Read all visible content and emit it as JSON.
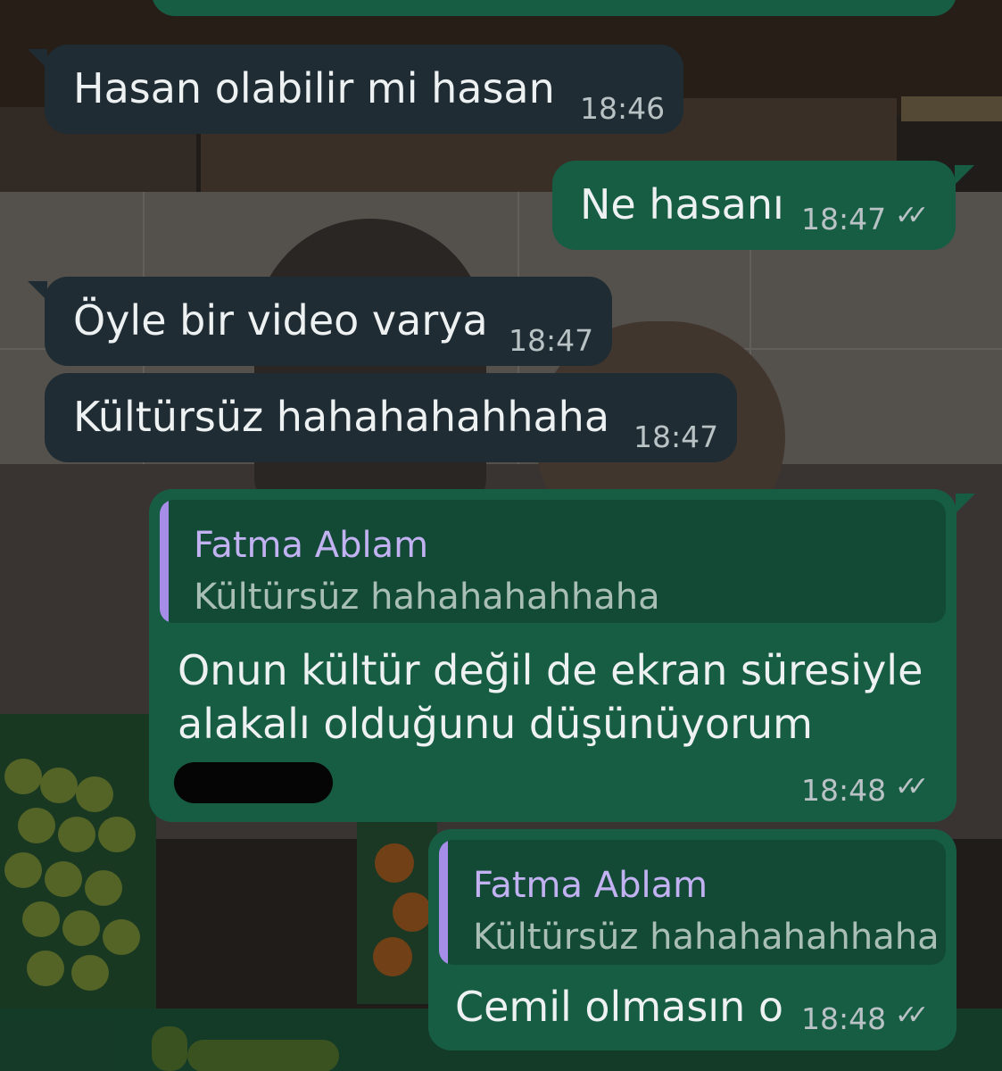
{
  "messages": [
    {
      "direction": "incoming",
      "text": "Hasan olabilir mi hasan",
      "time": "18:46"
    },
    {
      "direction": "outgoing",
      "text": "Ne hasanı",
      "time": "18:47",
      "status": "read"
    },
    {
      "direction": "incoming",
      "text": "Öyle bir video varya",
      "time": "18:47"
    },
    {
      "direction": "incoming",
      "text": "Kültürsüz hahahahahhaha",
      "time": "18:47"
    },
    {
      "direction": "outgoing",
      "quote": {
        "author": "Fatma Ablam",
        "text": "Kültürsüz hahahahahhaha"
      },
      "lines": [
        "Onun kültür değil de ekran süresiyle",
        "alakalı olduğunu düşünüyorum"
      ],
      "time": "18:48",
      "status": "read",
      "redacted": true
    },
    {
      "direction": "outgoing",
      "quote": {
        "author": "Fatma Ablam",
        "text": "Kültürsüz hahahahahhaha"
      },
      "text": "Cemil olmasın o",
      "time": "18:48",
      "status": "read"
    }
  ],
  "icons": {
    "read_receipt": "double-check-icon"
  },
  "colors": {
    "incoming_bubble": "#1f2c33",
    "outgoing_bubble": "#175d44",
    "quote_accent": "#a68ee8",
    "quote_author": "#c2b2f2"
  }
}
